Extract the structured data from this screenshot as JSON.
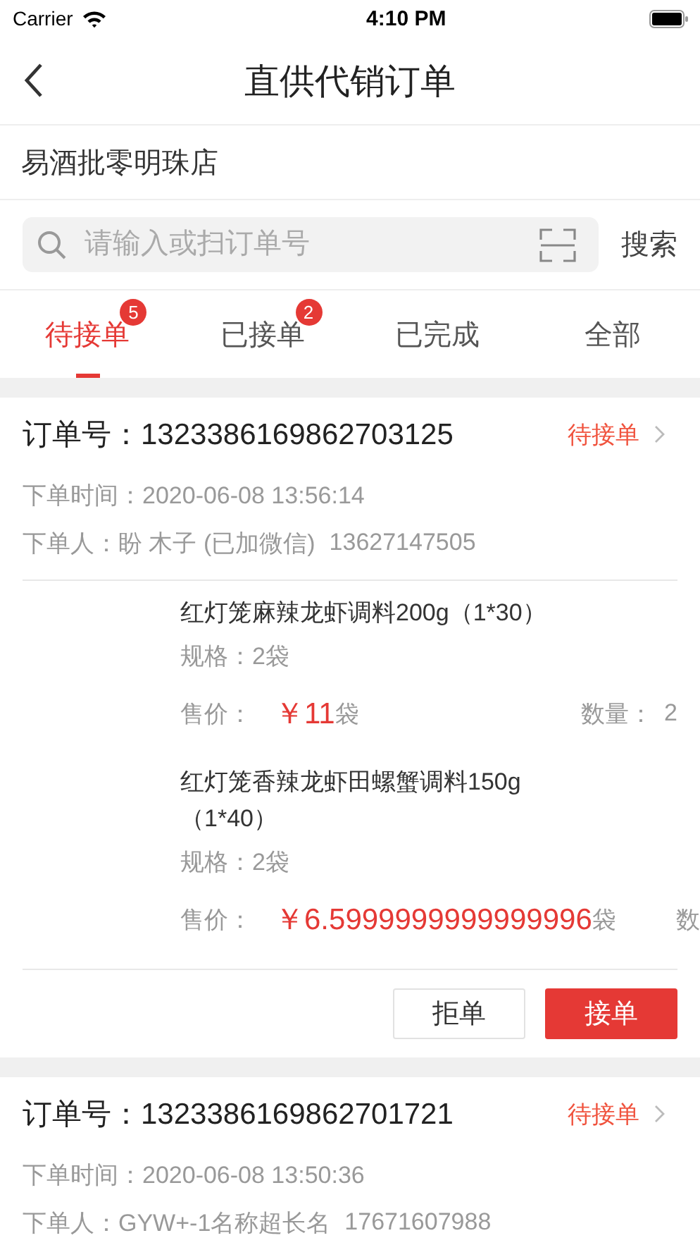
{
  "status_bar": {
    "carrier": "Carrier",
    "time": "4:10 PM"
  },
  "nav": {
    "title": "直供代销订单"
  },
  "store": {
    "name": "易酒批零明珠店"
  },
  "search": {
    "placeholder": "请输入或扫订单号",
    "button": "搜索"
  },
  "tabs": [
    {
      "label": "待接单",
      "badge": "5",
      "selected": true
    },
    {
      "label": "已接单",
      "badge": "2",
      "selected": false
    },
    {
      "label": "已完成",
      "selected": false
    },
    {
      "label": "全部",
      "selected": false
    }
  ],
  "orders": [
    {
      "number_label": "订单号：",
      "number": "1323386169862703125",
      "status": "待接单",
      "time_label": "下单时间：",
      "time": "2020-06-08 13:56:14",
      "buyer_label": "下单人：",
      "buyer": "盼 木子 (已加微信)",
      "phone": "13627147505",
      "items": [
        {
          "name": "红灯笼麻辣龙虾调料200g（1*30）",
          "spec_label": "规格：",
          "spec": "2袋",
          "price_label": "售价：",
          "currency": "￥",
          "price": "11",
          "unit": "袋",
          "quantity_label": "数量：",
          "quantity": "2"
        },
        {
          "name": "红灯笼香辣龙虾田螺蟹调料150g（1*40）",
          "spec_label": "规格：",
          "spec": "2袋",
          "price_label": "售价：",
          "currency": "￥",
          "price": "6.5999999999999996",
          "unit": "袋",
          "quantity_label": "数"
        }
      ],
      "actions": [
        {
          "label": "拒单",
          "kind": "secondary"
        },
        {
          "label": "接单",
          "kind": "primary"
        }
      ]
    },
    {
      "number_label": "订单号：",
      "number": "1323386169862701721",
      "status": "待接单",
      "time_label": "下单时间：",
      "time": "2020-06-08 13:50:36",
      "buyer_label": "下单人：",
      "buyer": "GYW+-1名称超长名",
      "phone": "17671607988"
    }
  ]
}
